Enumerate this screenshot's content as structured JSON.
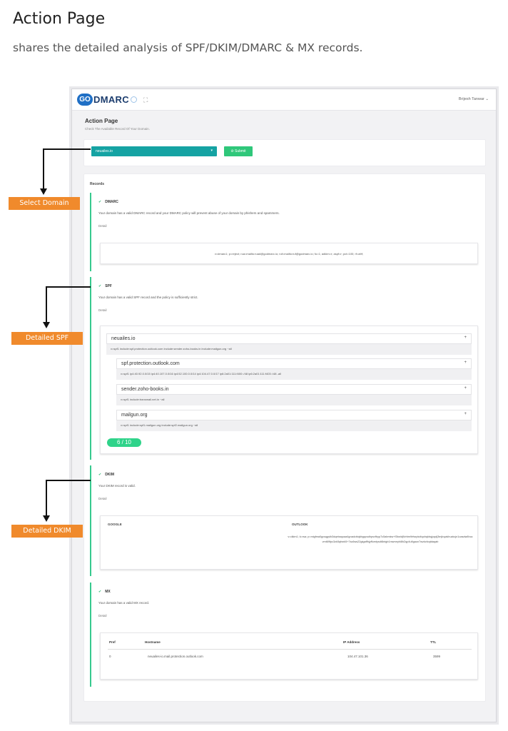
{
  "slide": {
    "title": "Action Page",
    "subtitle": "shares the detailed analysis of SPF/DKIM/DMARC & MX records."
  },
  "app": {
    "logo_go": "GO",
    "logo_text": "DMARC",
    "user": "Brijesh Tanwar",
    "page_title": "Action Page",
    "page_subtitle": "Check The Available Record Of Your Domain.",
    "domain_value": "neuailes.io",
    "submit_label": "⊘ Submit",
    "records_label": "Records",
    "detail_label": "Detail"
  },
  "dmarc": {
    "title": "DMARC",
    "desc": "Your domain has a valid DMARC record and your DMARC policy will prevent abuse of your domain by phishers and spammers.",
    "value": "v=dmarc1; p=reject; rua=mailto:ruad@godmarc.io; ruf=mailto:ruf@godmarc.io; fo=1; adkim=r; aspf=r; pct=100; rf=afrf;"
  },
  "spf": {
    "title": "SPF",
    "desc": "Your domain has a valid SPF record and the policy is sufficiently strict.",
    "root": {
      "host": "neuailes.io",
      "value": "v=spf1 include:spf.protection.outlook.com include:sender.zoho-books.in include:mailgun.org ~all"
    },
    "includes": [
      {
        "host": "spf.protection.outlook.com",
        "value": "v=spf1 ip4:40.92.0.0/15 ip4:40.107.0.0/16 ip4:52.100.0.0/14 ip4:104.47.0.0/17 ip6:2a01:111:f400::/48 ip6:2a01:111:f403::/48 -all"
      },
      {
        "host": "sender.zoho-books.in",
        "value": "v=spf1 include:transmail.net.in ~all"
      },
      {
        "host": "mailgun.org",
        "value": "v=spf1 include:spf1.mailgun.org include:spf2.mailgun.org ~all"
      }
    ],
    "score": "6 / 10"
  },
  "dkim": {
    "title": "DKIM",
    "desc": "Your DKIM record is valid.",
    "col_google": "GOOGLE",
    "col_outlook": "OUTLOOK",
    "value": "v=dkim1; k=rsa; p=migfma0gcsqgsib3dqebaquaa4gnadcbiqkbgqcsdhpsvfbyp7c5abmkw+f3bztdj9vhtm9rfwrpkdtqohqkbqjuqdj3mjtoyakhuzkcjn1oasdw6hocvmt69fpc3zk5qfwrk5+7sc6ws22gtgaffhjyffumtysdt8ntgb1mwnephi8h2qp4u9gaun7wzkcfcqtdaqab"
  },
  "mx": {
    "title": "MX",
    "desc": "Your domain has a valid MX record.",
    "headers": [
      "Pref",
      "Hostname",
      "IP Address",
      "TTL"
    ],
    "rows": [
      {
        "pref": "0",
        "host": "neuailes-io.mail.protection.outlook.com",
        "ip": "104.47.101.36",
        "ttl": "3599"
      }
    ]
  },
  "callouts": {
    "select_domain": "Select Domain",
    "detailed_spf": "Detailed SPF",
    "detailed_dkim": "Detailed DKIM"
  }
}
